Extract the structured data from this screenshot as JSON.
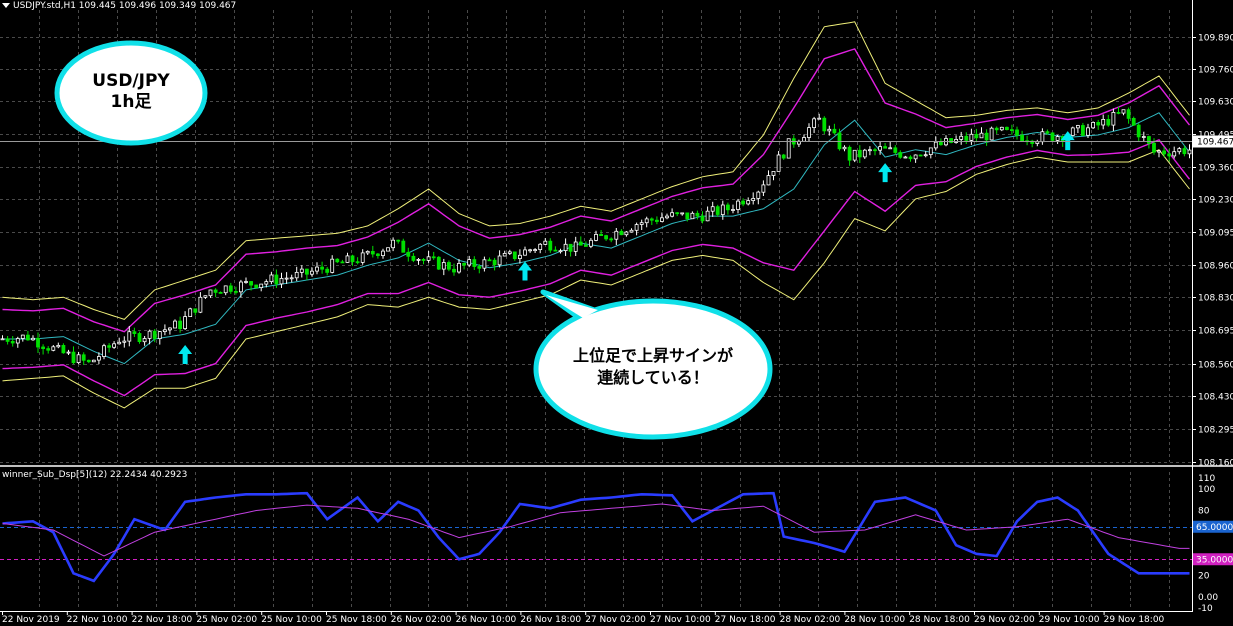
{
  "header": {
    "symbol_line": "USDJPY.std,H1  109.445 109.496 109.349 109.467",
    "sub_line": "winner_Sub_Dsp[5](12) 22.2434 40.2923"
  },
  "callouts": {
    "top": "USD/JPY\n1h足",
    "mid": "上位足で上昇サインが\n連続している！"
  },
  "colors": {
    "background": "#000000",
    "grid": "#4a4a4a",
    "bull": "#ffffff",
    "bear": "#00e000",
    "band_outer": "#f0f07a",
    "band_mid": "#e020e0",
    "center": "#30b8c0",
    "arrow": "#00e8f0",
    "osc_main": "#2a3cff",
    "osc_signal": "#c040e0",
    "level_65": "#1a64d0",
    "level_35": "#d020c0",
    "price_tag": "#ffffff",
    "callout_fill": "#ffffff",
    "callout_border": "#10e0e8"
  },
  "chart_data": [
    {
      "type": "candlestick",
      "title": "USDJPY.std,H1",
      "ylim": [
        108.16,
        109.99
      ],
      "y_ticks": [
        "109.890",
        "109.760",
        "109.630",
        "109.495",
        "109.360",
        "109.230",
        "109.095",
        "108.960",
        "108.830",
        "108.695",
        "108.560",
        "108.430",
        "108.295",
        "108.160"
      ],
      "current_price": "109.467",
      "x_ticks": [
        "22 Nov 2019",
        "22 Nov 10:00",
        "22 Nov 18:00",
        "25 Nov 02:00",
        "25 Nov 10:00",
        "25 Nov 18:00",
        "26 Nov 02:00",
        "26 Nov 10:00",
        "26 Nov 18:00",
        "27 Nov 02:00",
        "27 Nov 10:00",
        "27 Nov 18:00",
        "28 Nov 02:00",
        "28 Nov 10:00",
        "28 Nov 18:00",
        "29 Nov 02:00",
        "29 Nov 10:00",
        "29 Nov 18:00"
      ],
      "price_anchors": [
        [
          0,
          108.66
        ],
        [
          6,
          108.67
        ],
        [
          12,
          108.61
        ],
        [
          18,
          108.56
        ],
        [
          24,
          108.66
        ],
        [
          30,
          108.68
        ],
        [
          36,
          108.72
        ],
        [
          42,
          108.86
        ],
        [
          48,
          108.88
        ],
        [
          54,
          108.9
        ],
        [
          60,
          108.92
        ],
        [
          66,
          108.96
        ],
        [
          72,
          108.99
        ],
        [
          78,
          109.05
        ],
        [
          84,
          108.98
        ],
        [
          90,
          108.95
        ],
        [
          96,
          108.97
        ],
        [
          102,
          109.0
        ],
        [
          108,
          109.05
        ],
        [
          114,
          109.03
        ],
        [
          120,
          109.08
        ],
        [
          126,
          109.13
        ],
        [
          132,
          109.16
        ],
        [
          138,
          109.16
        ],
        [
          144,
          109.19
        ],
        [
          150,
          109.27
        ],
        [
          156,
          109.45
        ],
        [
          162,
          109.55
        ],
        [
          168,
          109.4
        ],
        [
          174,
          109.43
        ],
        [
          180,
          109.41
        ],
        [
          186,
          109.45
        ],
        [
          192,
          109.48
        ],
        [
          198,
          109.5
        ],
        [
          204,
          109.48
        ],
        [
          210,
          109.49
        ],
        [
          216,
          109.52
        ],
        [
          222,
          109.58
        ],
        [
          228,
          109.42
        ],
        [
          234,
          109.43
        ]
      ],
      "bands": [
        {
          "name": "outer",
          "offsets": [
            0.17,
            0.16,
            0.16,
            0.17,
            0.18,
            0.2,
            0.22,
            0.22,
            0.2,
            0.19,
            0.18,
            0.17,
            0.16,
            0.2,
            0.22,
            0.19,
            0.17,
            0.16,
            0.16,
            0.15,
            0.15,
            0.15,
            0.15,
            0.16,
            0.18,
            0.3,
            0.45,
            0.48,
            0.4,
            0.3,
            0.2,
            0.15,
            0.12,
            0.11,
            0.1,
            0.1,
            0.11,
            0.14,
            0.15,
            0.15
          ]
        },
        {
          "name": "mid",
          "offsets": [
            0.12,
            0.115,
            0.115,
            0.12,
            0.13,
            0.145,
            0.16,
            0.16,
            0.145,
            0.135,
            0.13,
            0.12,
            0.115,
            0.145,
            0.16,
            0.14,
            0.12,
            0.115,
            0.115,
            0.11,
            0.11,
            0.11,
            0.11,
            0.115,
            0.13,
            0.22,
            0.33,
            0.35,
            0.29,
            0.22,
            0.145,
            0.11,
            0.088,
            0.08,
            0.073,
            0.073,
            0.08,
            0.1,
            0.11,
            0.11
          ]
        }
      ],
      "signal_arrows": [
        {
          "bar": 36,
          "price": 108.66
        },
        {
          "bar": 103,
          "price": 109.0
        },
        {
          "bar": 174,
          "price": 109.4
        },
        {
          "bar": 210,
          "price": 109.53
        }
      ]
    },
    {
      "type": "line",
      "title": "winner_Sub_Dsp[5](12)",
      "ylim": [
        -10,
        110
      ],
      "y_ticks": [
        "110",
        "100",
        "80",
        "65.0000",
        "35.0000",
        "20",
        "0.00",
        "-10"
      ],
      "levels": [
        65,
        35
      ],
      "series": [
        {
          "name": "main",
          "anchors": [
            [
              0,
              68
            ],
            [
              6,
              70
            ],
            [
              10,
              60
            ],
            [
              14,
              22
            ],
            [
              18,
              15
            ],
            [
              22,
              40
            ],
            [
              26,
              72
            ],
            [
              32,
              62
            ],
            [
              36,
              88
            ],
            [
              42,
              92
            ],
            [
              48,
              95
            ],
            [
              54,
              95
            ],
            [
              60,
              96
            ],
            [
              64,
              72
            ],
            [
              70,
              92
            ],
            [
              74,
              70
            ],
            [
              78,
              88
            ],
            [
              82,
              80
            ],
            [
              86,
              55
            ],
            [
              90,
              35
            ],
            [
              94,
              40
            ],
            [
              98,
              60
            ],
            [
              102,
              86
            ],
            [
              108,
              82
            ],
            [
              114,
              90
            ],
            [
              120,
              92
            ],
            [
              126,
              95
            ],
            [
              132,
              94
            ],
            [
              136,
              70
            ],
            [
              142,
              85
            ],
            [
              146,
              95
            ],
            [
              152,
              96
            ],
            [
              154,
              56
            ],
            [
              160,
              50
            ],
            [
              166,
              42
            ],
            [
              172,
              88
            ],
            [
              178,
              92
            ],
            [
              184,
              80
            ],
            [
              188,
              48
            ],
            [
              192,
              40
            ],
            [
              196,
              38
            ],
            [
              200,
              70
            ],
            [
              204,
              88
            ],
            [
              208,
              92
            ],
            [
              212,
              80
            ],
            [
              218,
              40
            ],
            [
              224,
              22
            ],
            [
              232,
              22
            ]
          ]
        },
        {
          "name": "signal",
          "anchors": [
            [
              0,
              68
            ],
            [
              10,
              62
            ],
            [
              20,
              38
            ],
            [
              30,
              60
            ],
            [
              40,
              70
            ],
            [
              50,
              80
            ],
            [
              60,
              85
            ],
            [
              70,
              82
            ],
            [
              80,
              72
            ],
            [
              90,
              55
            ],
            [
              100,
              65
            ],
            [
              110,
              78
            ],
            [
              120,
              82
            ],
            [
              130,
              86
            ],
            [
              140,
              80
            ],
            [
              150,
              84
            ],
            [
              160,
              60
            ],
            [
              170,
              62
            ],
            [
              180,
              76
            ],
            [
              190,
              62
            ],
            [
              200,
              65
            ],
            [
              210,
              72
            ],
            [
              220,
              55
            ],
            [
              232,
              45
            ]
          ]
        }
      ]
    }
  ]
}
